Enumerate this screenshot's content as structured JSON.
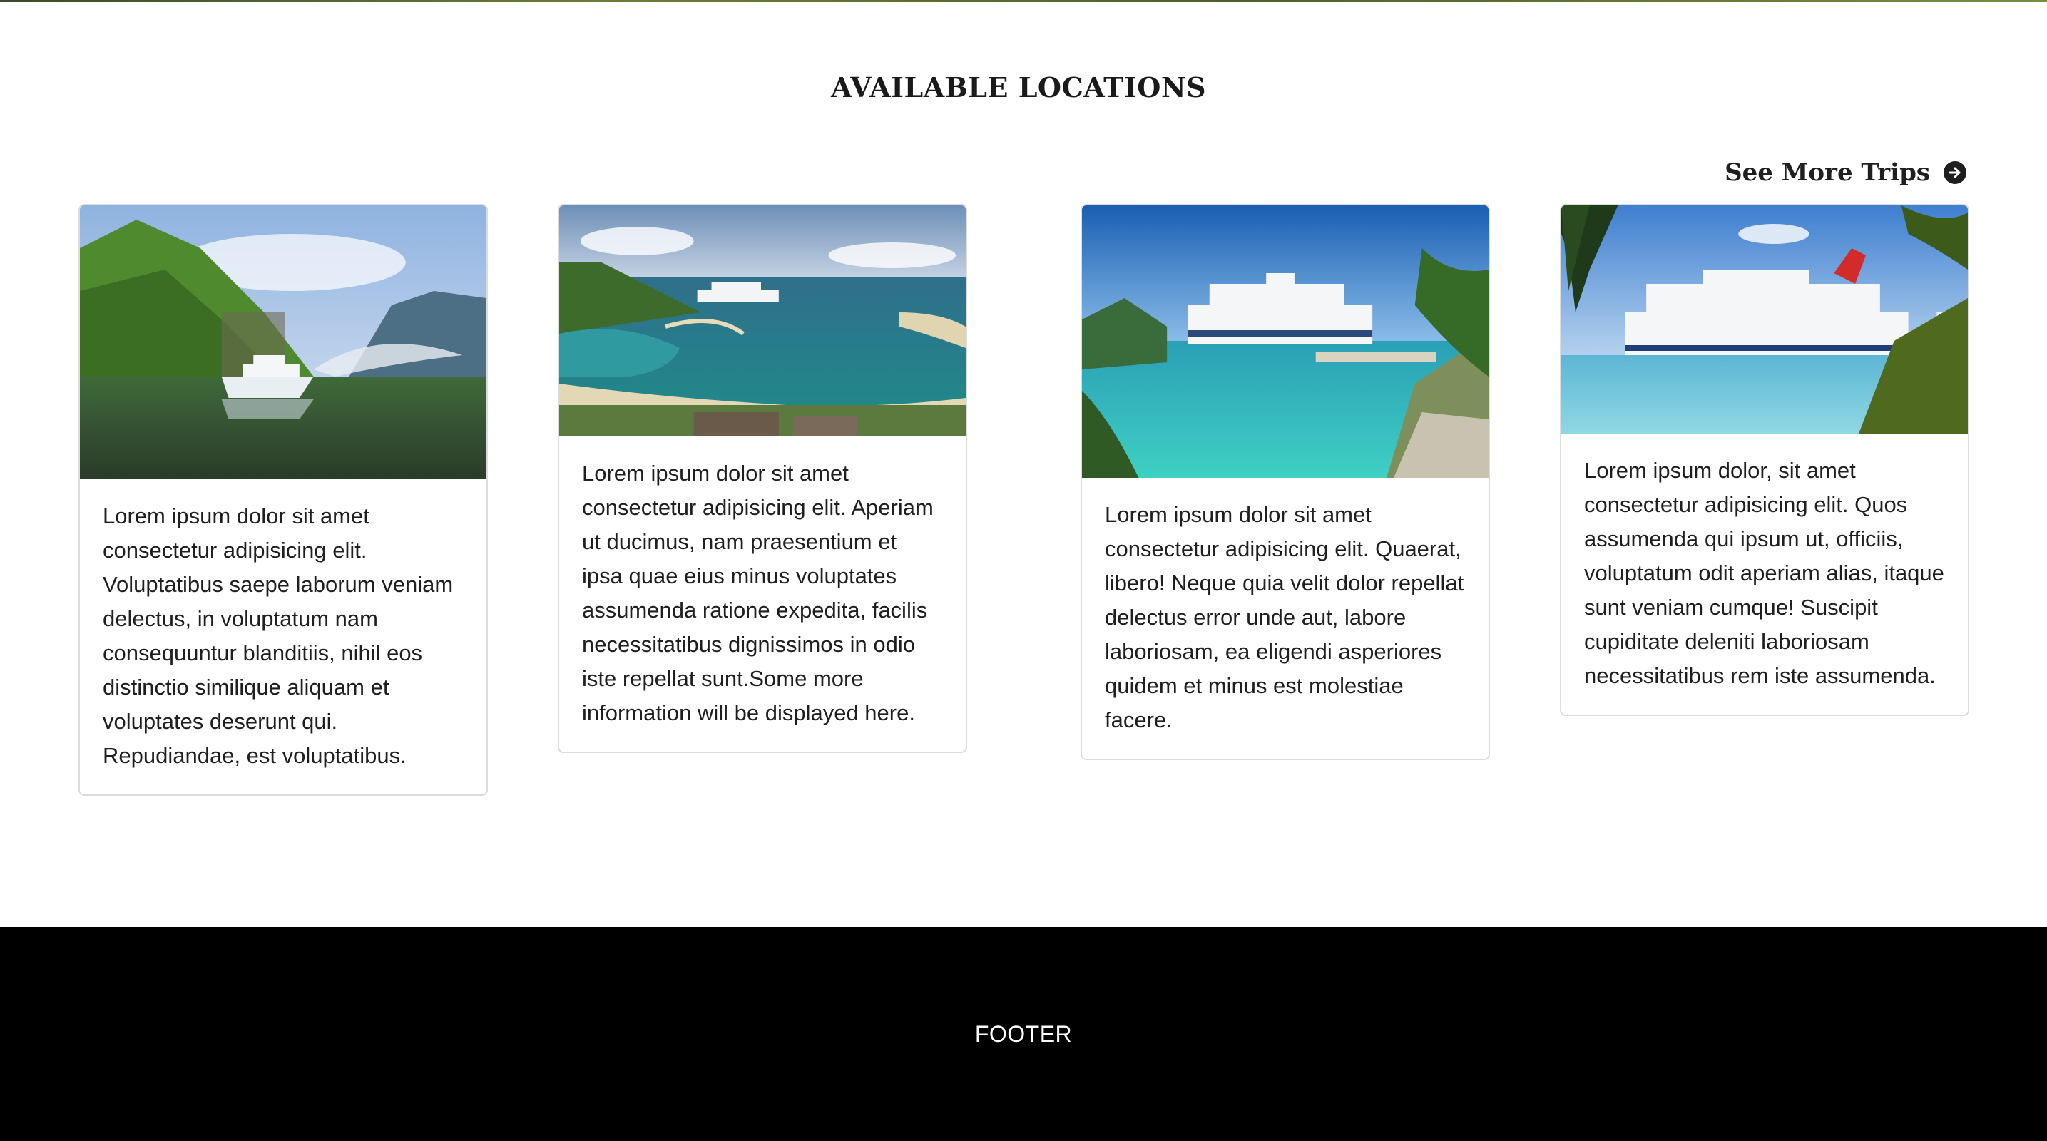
{
  "section": {
    "title": "AVAILABLE LOCATIONS",
    "see_more_label": "See More Trips",
    "see_more_icon": "arrow-right-circle-icon"
  },
  "cards": [
    {
      "image": "cruise-ship-fjord-photo",
      "text": "Lorem ipsum dolor sit amet consectetur adipisicing elit. Voluptatibus saepe laborum veniam delectus, in voluptatum nam consequuntur blanditiis, nihil eos distinctio similique aliquam et voluptates deserunt qui. Repudiandae, est voluptatibus."
    },
    {
      "image": "cruise-ship-bay-photo",
      "text": "Lorem ipsum dolor sit amet consectetur adipisicing elit. Aperiam ut ducimus, nam praesentium et ipsa quae eius minus voluptates assumenda ratione expedita, facilis necessitatibus dignissimos in odio iste repellat sunt.Some more information will be displayed here."
    },
    {
      "image": "cruise-ship-lagoon-photo",
      "text": "Lorem ipsum dolor sit amet consectetur adipisicing elit. Quaerat, libero! Neque quia velit dolor repellat delectus error unde aut, labore laboriosam, ea eligendi asperiores quidem et minus est molestiae facere."
    },
    {
      "image": "cruise-ship-beach-photo",
      "text": "Lorem ipsum dolor, sit amet consectetur adipisicing elit. Quos assumenda qui ipsum ut, officiis, voluptatum odit aperiam alias, itaque sunt veniam cumque! Suscipit cupiditate deleniti laboriosam necessitatibus rem iste assumenda."
    }
  ],
  "footer": {
    "text": "FOOTER"
  },
  "colors": {
    "footer_bg": "#000000",
    "card_border": "#dcdcdc",
    "text": "#1f1f1f"
  }
}
